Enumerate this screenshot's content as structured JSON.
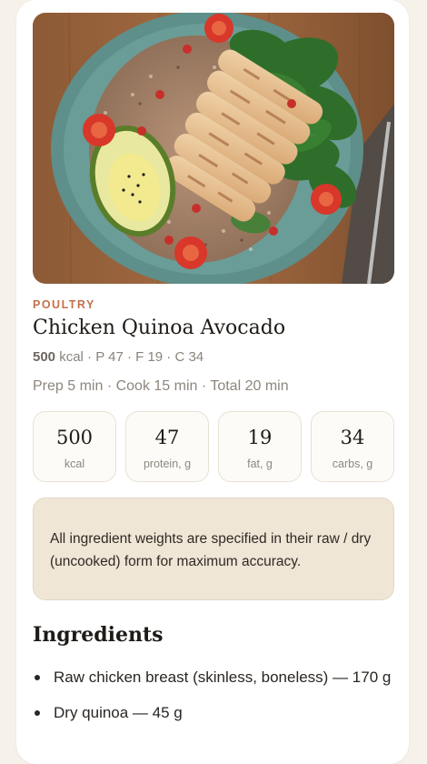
{
  "recipe": {
    "category": "POULTRY",
    "title": "Chicken Quinoa Avocado",
    "macros": {
      "kcal_value": "500",
      "kcal_rest": " kcal · P 47 · F 19 · C 34"
    },
    "times": "Prep 5 min · Cook 15 min · Total 20 min",
    "stats": [
      {
        "value": "500",
        "label": "kcal"
      },
      {
        "value": "47",
        "label": "protein, g"
      },
      {
        "value": "19",
        "label": "fat, g"
      },
      {
        "value": "34",
        "label": "carbs, g"
      }
    ],
    "note": "All ingredient weights are specified in their raw / dry (uncooked) form for maximum accuracy.",
    "ingredients_heading": "Ingredients",
    "ingredients": [
      "Raw chicken breast (skinless, boneless) — 170 g",
      "Dry quinoa — 45 g"
    ]
  },
  "colors": {
    "accent": "#c4714c",
    "page_background": "#f6f2ea",
    "note_background": "#efe6d6"
  }
}
